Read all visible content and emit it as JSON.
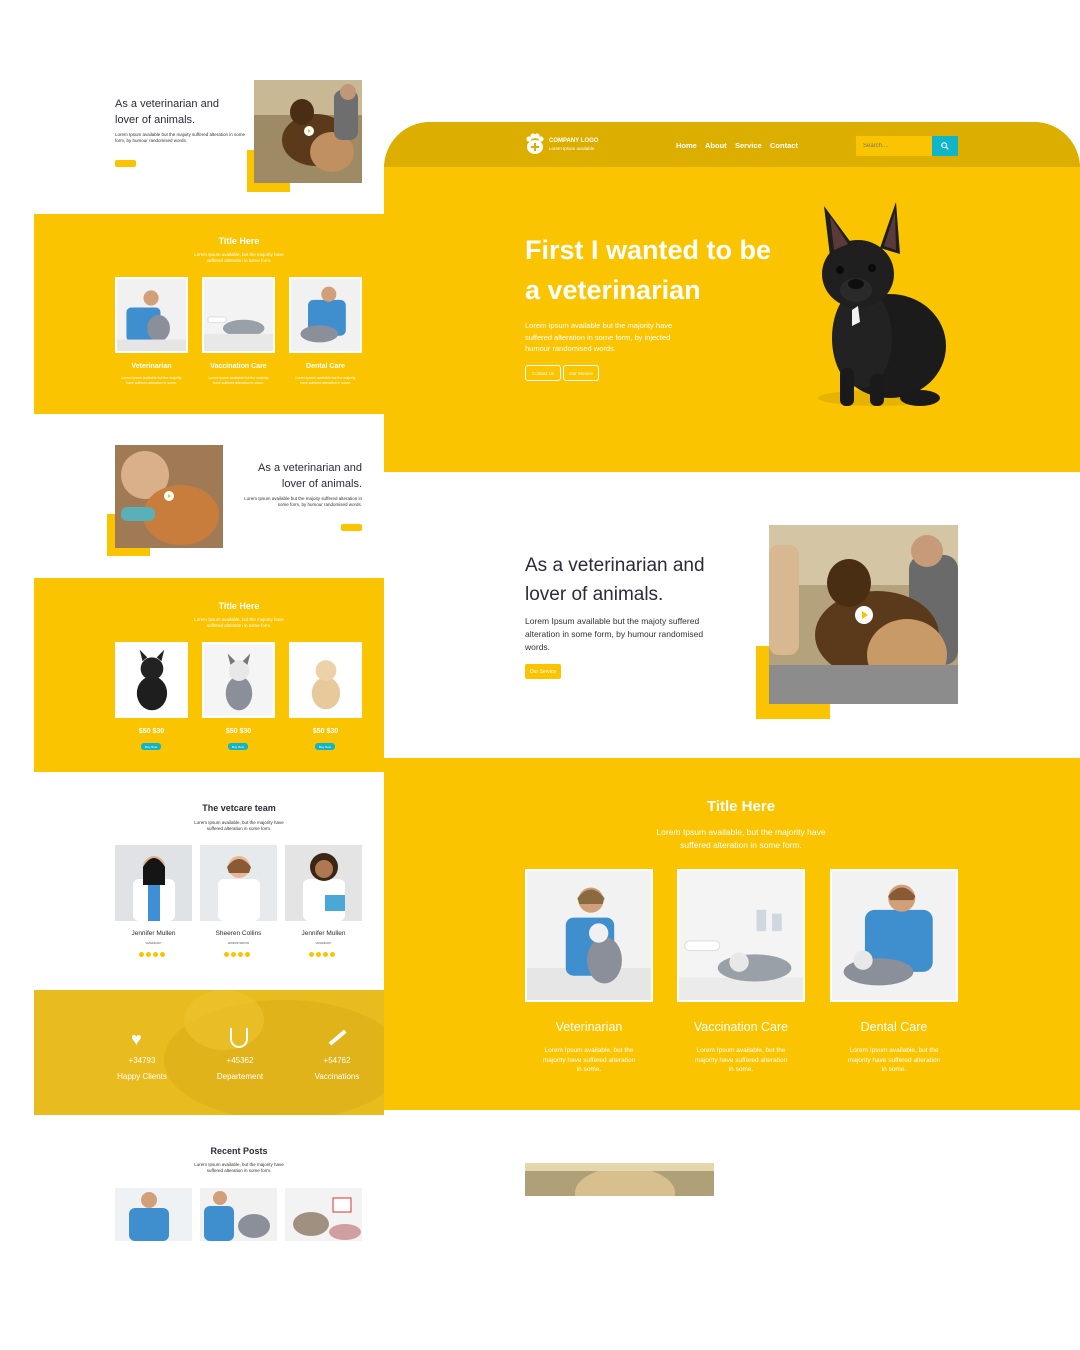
{
  "left": {
    "about1": {
      "title_line1": "As a veterinarian and",
      "title_line2": "lover of animals.",
      "text": "Lorem Ipsum available but the majoity suffered alteration in some form, by humour randomised words.",
      "btn": "Our Service"
    },
    "services": {
      "title": "Title Here",
      "subtitle_line1": "Lorem Ipsum available, but the majority have",
      "subtitle_line2": "suffered alteration in some form.",
      "items": [
        {
          "name": "Veterinarian",
          "text": "Lorem Ipsum available but the majority have suffered alteration in some."
        },
        {
          "name": "Vaccination Care",
          "text": "Lorem Ipsum available but the majority have suffered alteration in some."
        },
        {
          "name": "Dental Care",
          "text": "Lorem Ipsum available but the majority have suffered alteration in some."
        }
      ]
    },
    "about2": {
      "title_line1": "As a veterinarian and",
      "title_line2": "lover of animals.",
      "text": "Lorem Ipsum available but the majoity suffered alteration in some form, by humour randomised words.",
      "btn": "Our Service"
    },
    "shop": {
      "title": "Title Here",
      "subtitle_line1": "Lorem Ipsum available, but the majority have",
      "subtitle_line2": "suffered alteration in some form.",
      "items": [
        {
          "price": "$50 $30",
          "btn": "Buy Now"
        },
        {
          "price": "$50 $30",
          "btn": "Buy Now"
        },
        {
          "price": "$50 $30",
          "btn": "Buy Now"
        }
      ]
    },
    "team": {
      "title": "The vetcare team",
      "subtitle_line1": "Lorem Ipsum available, but the majority have",
      "subtitle_line2": "suffered alteration in some form.",
      "members": [
        {
          "name": "Jennifer Mullen",
          "role": "VETERINARY"
        },
        {
          "name": "Sheeren Collins",
          "role": "ADMINISTRATION"
        },
        {
          "name": "Jennifer Mullen",
          "role": "VETERINARY"
        }
      ]
    },
    "stats": [
      {
        "value": "+34793",
        "label": "Happy Clients",
        "icon": "heart-plus-icon"
      },
      {
        "value": "+45362",
        "label": "Departement",
        "icon": "stethoscope-icon"
      },
      {
        "value": "+54762",
        "label": "Vaccinations",
        "icon": "syringe-icon"
      }
    ],
    "posts": {
      "title": "Recent Posts",
      "subtitle_line1": "Lorem Ipsum available, but the majority have",
      "subtitle_line2": "suffered alteration in some form."
    }
  },
  "right": {
    "nav": {
      "logo_title": "COMPANY LOGO",
      "logo_sub": "Lorem Ipsum available",
      "links": [
        "Home",
        "About",
        "Service",
        "Contact"
      ],
      "search_placeholder": "Search...."
    },
    "hero": {
      "title_line1": "First I wanted to be",
      "title_line2": "a veterinarian",
      "text_line1": "Lorem Ipsum available but the majority have",
      "text_line2": "suffered alteration in some form, by injected",
      "text_line3": "humour randomised words.",
      "btn1": "Contact Us",
      "btn2": "Our Service"
    },
    "about": {
      "title_line1": "As a veterinarian and",
      "title_line2": "lover of animals.",
      "text_line1": "Lorem Ipsum available but the majoty suffered",
      "text_line2": "alteration in some form, by humour randomised",
      "text_line3": "words.",
      "btn": "Our Service"
    },
    "services": {
      "title": "Title Here",
      "subtitle_line1": "Lorem Ipsum available, but the majority have",
      "subtitle_line2": "suffered alteration in some form.",
      "items": [
        {
          "name": "Veterinarian",
          "text_line1": "Lorem Ipsum available, but the",
          "text_line2": "majority have suffered alteration",
          "text_line3": "in some."
        },
        {
          "name": "Vaccination Care",
          "text_line1": "Lorem Ipsum available, but the",
          "text_line2": "majority have suffered alteration",
          "text_line3": "in some."
        },
        {
          "name": "Dental Care",
          "text_line1": "Lorem Ipsum available, but the",
          "text_line2": "majority have suffered alteration",
          "text_line3": "in some."
        }
      ]
    }
  },
  "colors": {
    "accent": "#fbc400",
    "header": "#dcae00",
    "teal": "#0fb5c9",
    "dark_text": "#2b2b3a"
  }
}
